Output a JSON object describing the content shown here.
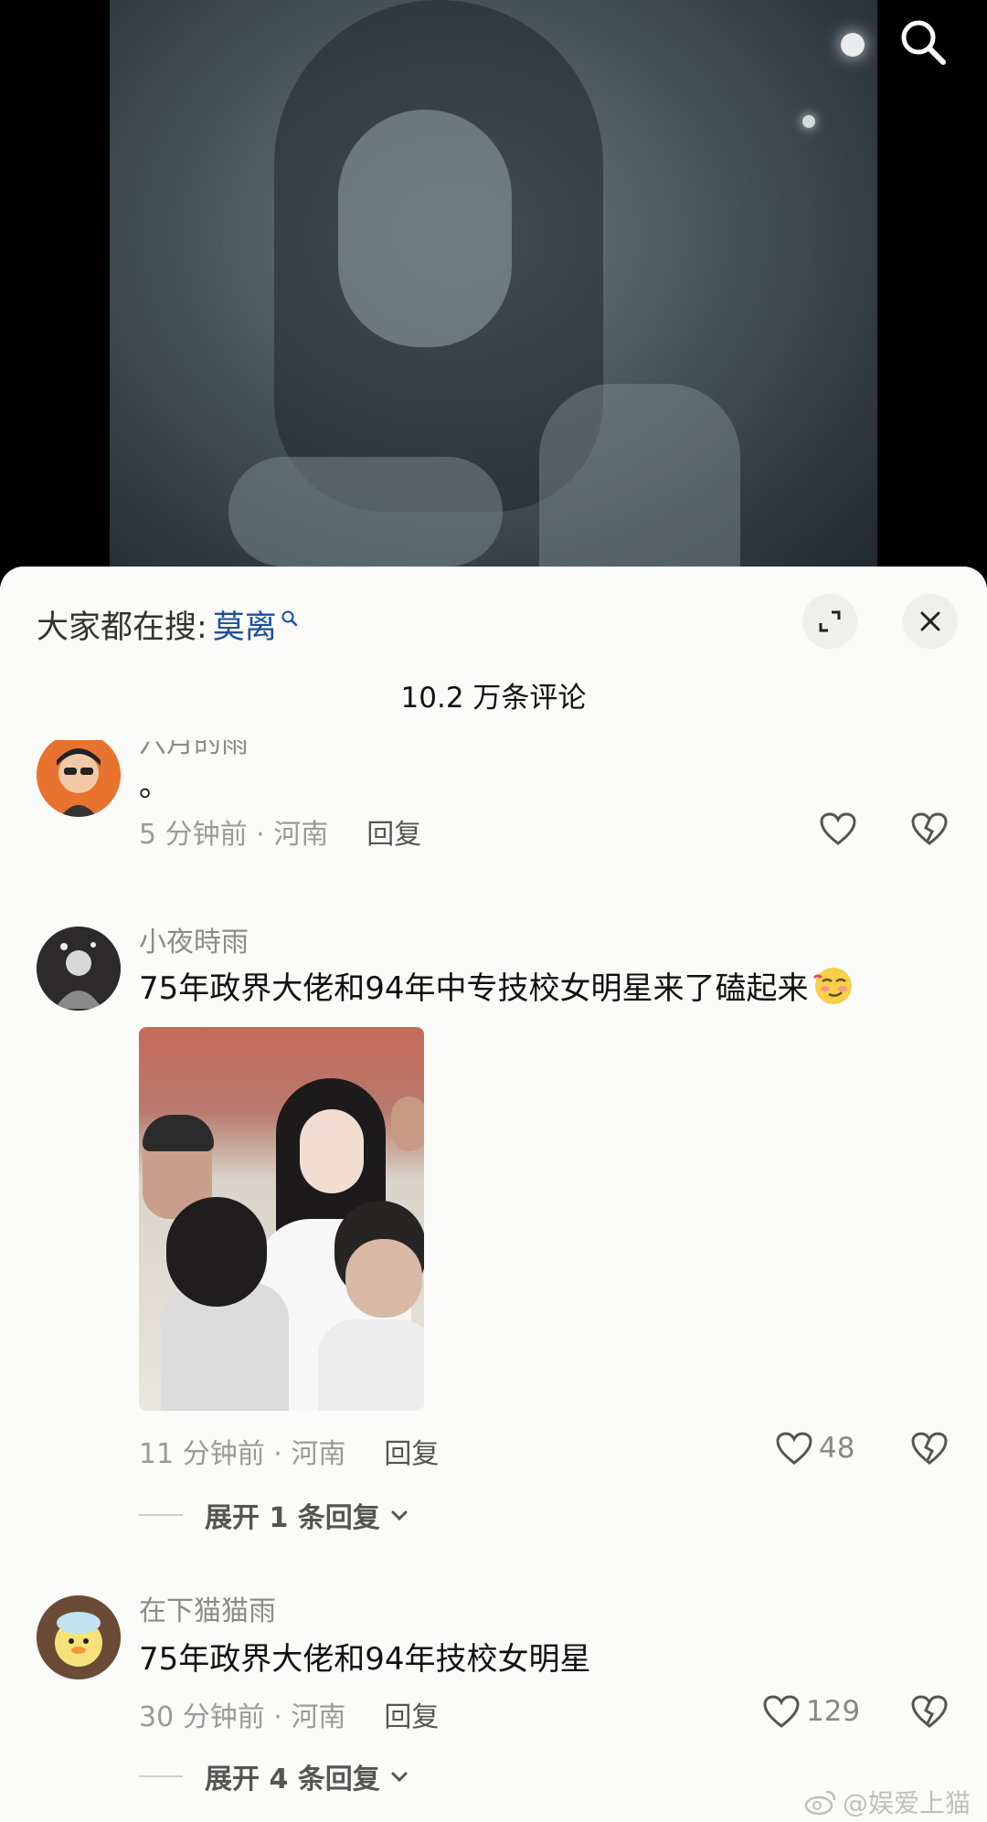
{
  "header": {
    "search_prefix": "大家都在搜:",
    "search_keyword": "莫离",
    "comment_count": "10.2 万条评论"
  },
  "comments": [
    {
      "username": "六月的雨",
      "text": "。",
      "time_location": "5 分钟前 · 河南",
      "reply_label": "回复",
      "likes": ""
    },
    {
      "username": "小夜時雨",
      "text": "75年政界大佬和94年中专技校女明星来了磕起来",
      "emoji": "smirk-face-emoji",
      "time_location": "11 分钟前 · 河南",
      "reply_label": "回复",
      "likes": "48",
      "expand_label": "展开 1 条回复"
    },
    {
      "username": "在下猫猫雨",
      "text": "75年政界大佬和94年技校女明星",
      "time_location": "30 分钟前 · 河南",
      "reply_label": "回复",
      "likes": "129",
      "expand_label": "展开 4 条回复"
    }
  ],
  "watermark": "@娱爱上猫",
  "icons": {
    "top_search": "search-icon",
    "expand": "expand-icon",
    "close": "close-icon",
    "like": "heart-icon",
    "dislike": "broken-heart-icon",
    "chevron": "chevron-down-icon",
    "weibo": "weibo-icon"
  },
  "colors": {
    "keyword": "#1d4f9b",
    "sheet_bg": "#fbfbf9",
    "muted_text": "#9a9a9a"
  }
}
